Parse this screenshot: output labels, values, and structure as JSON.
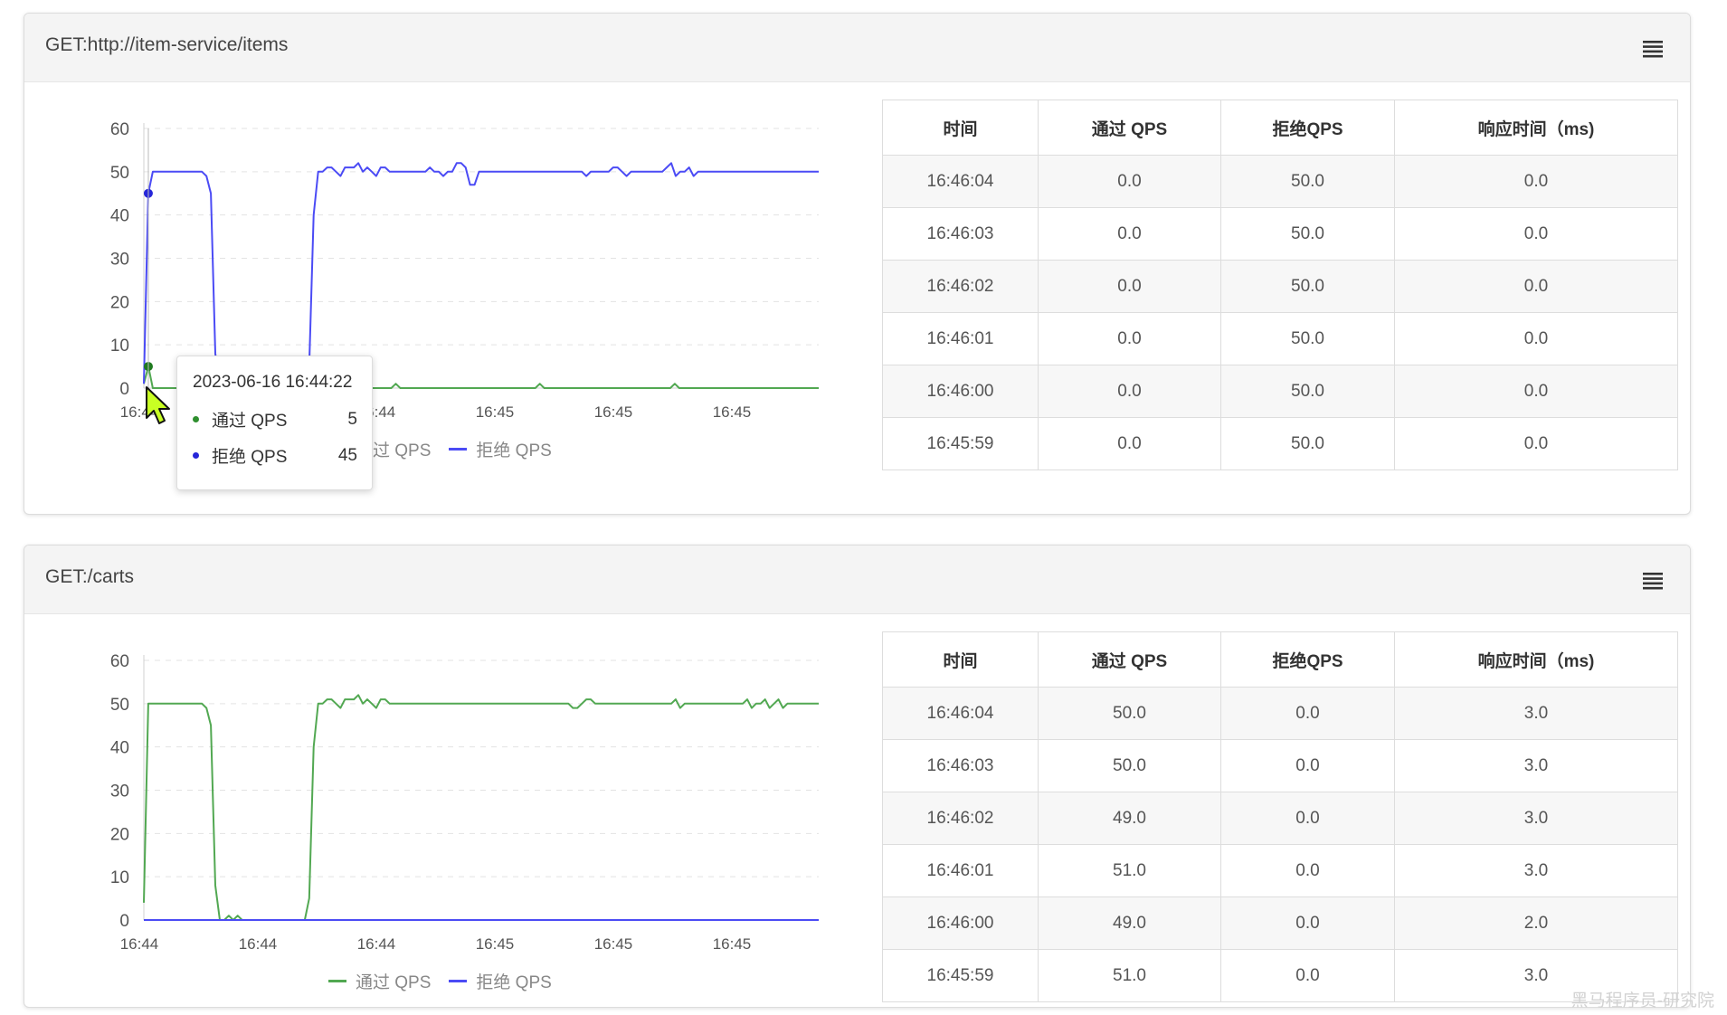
{
  "colors": {
    "pass": "#52a852",
    "reject": "#4b4bf5"
  },
  "panels": [
    {
      "title": "GET:http://item-service/items",
      "legend": [
        "通过 QPS",
        "拒绝 QPS"
      ],
      "table": {
        "headers": [
          "时间",
          "通过 QPS",
          "拒绝QPS",
          "响应时间（ms)"
        ],
        "rows": [
          [
            "16:46:04",
            "0.0",
            "50.0",
            "0.0"
          ],
          [
            "16:46:03",
            "0.0",
            "50.0",
            "0.0"
          ],
          [
            "16:46:02",
            "0.0",
            "50.0",
            "0.0"
          ],
          [
            "16:46:01",
            "0.0",
            "50.0",
            "0.0"
          ],
          [
            "16:46:00",
            "0.0",
            "50.0",
            "0.0"
          ],
          [
            "16:45:59",
            "0.0",
            "50.0",
            "0.0"
          ]
        ]
      },
      "tooltip": {
        "title": "2023-06-16 16:44:22",
        "rows": [
          {
            "label": "通过 QPS",
            "value": "5"
          },
          {
            "label": "拒绝 QPS",
            "value": "45"
          }
        ]
      }
    },
    {
      "title": "GET:/carts",
      "legend": [
        "通过 QPS",
        "拒绝 QPS"
      ],
      "table": {
        "headers": [
          "时间",
          "通过 QPS",
          "拒绝QPS",
          "响应时间（ms)"
        ],
        "rows": [
          [
            "16:46:04",
            "50.0",
            "0.0",
            "3.0"
          ],
          [
            "16:46:03",
            "50.0",
            "0.0",
            "3.0"
          ],
          [
            "16:46:02",
            "49.0",
            "0.0",
            "3.0"
          ],
          [
            "16:46:01",
            "51.0",
            "0.0",
            "3.0"
          ],
          [
            "16:46:00",
            "49.0",
            "0.0",
            "2.0"
          ],
          [
            "16:45:59",
            "51.0",
            "0.0",
            "3.0"
          ]
        ]
      }
    }
  ],
  "watermark": "黑马程序员-研究院",
  "chart_data": [
    {
      "type": "line",
      "ylim": [
        0,
        60
      ],
      "yticks": [
        0,
        10,
        20,
        30,
        40,
        50,
        60
      ],
      "x_tick_labels": [
        "16:44",
        "16:44",
        "16:44",
        "16:45",
        "16:45",
        "16:45"
      ],
      "grid": "horizontal dashed",
      "legend_position": "bottom-center",
      "series": [
        {
          "name": "通过 QPS",
          "color": "#52a852",
          "values": [
            1,
            5,
            0,
            0,
            0,
            0,
            0,
            0,
            0,
            0,
            0,
            0,
            0,
            0,
            0,
            0,
            0,
            0,
            0,
            0,
            0,
            0,
            0,
            0,
            0,
            0,
            0,
            0,
            0,
            0,
            0,
            0,
            0,
            0,
            0,
            0,
            0,
            0,
            0,
            0,
            0,
            0,
            0,
            0,
            0,
            0,
            0,
            0,
            0,
            0,
            0,
            0,
            0,
            0,
            0,
            0,
            1,
            0,
            0,
            0,
            0,
            0,
            0,
            0,
            0,
            0,
            0,
            0,
            0,
            0,
            0,
            0,
            0,
            0,
            0,
            0,
            0,
            0,
            0,
            0,
            0,
            0,
            0,
            0,
            0,
            0,
            0,
            0,
            1,
            0,
            0,
            0,
            0,
            0,
            0,
            0,
            0,
            0,
            0,
            0,
            0,
            0,
            0,
            0,
            0,
            0,
            0,
            0,
            0,
            0,
            0,
            0,
            0,
            0,
            0,
            0,
            0,
            0,
            1,
            0,
            0,
            0,
            0,
            0,
            0,
            0,
            0,
            0,
            0,
            0,
            0,
            0,
            0,
            0,
            0,
            0,
            0,
            0,
            0,
            0,
            0,
            0,
            0,
            0,
            0,
            0,
            0,
            0,
            0,
            0,
            0
          ]
        },
        {
          "name": "拒绝 QPS",
          "color": "#4b4bf5",
          "values": [
            1,
            45,
            50,
            50,
            50,
            50,
            50,
            50,
            50,
            50,
            50,
            50,
            50,
            50,
            49,
            45,
            8,
            0,
            0,
            0,
            0,
            0,
            0,
            0,
            0,
            0,
            0,
            0,
            0,
            0,
            0,
            0,
            0,
            0,
            0,
            0,
            0,
            5,
            40,
            50,
            50,
            51,
            51,
            50,
            49,
            51,
            51,
            51,
            52,
            50,
            51,
            50,
            49,
            51,
            51,
            50,
            50,
            50,
            50,
            50,
            50,
            50,
            50,
            50,
            51,
            50,
            50,
            49,
            50,
            50,
            52,
            52,
            51,
            47,
            47,
            50,
            50,
            50,
            50,
            50,
            50,
            50,
            50,
            50,
            50,
            50,
            50,
            50,
            50,
            50,
            50,
            50,
            50,
            50,
            50,
            50,
            50,
            50,
            50,
            49,
            50,
            50,
            50,
            50,
            50,
            51,
            51,
            50,
            49,
            50,
            50,
            50,
            50,
            50,
            50,
            50,
            50,
            51,
            52,
            49,
            50,
            50,
            51,
            49,
            50,
            50,
            50,
            50,
            50,
            50,
            50,
            50,
            50,
            50,
            50,
            50,
            50,
            50,
            50,
            50,
            50,
            50,
            50,
            50,
            50,
            50,
            50,
            50,
            50,
            50,
            50,
            50
          ]
        }
      ]
    },
    {
      "type": "line",
      "ylim": [
        0,
        60
      ],
      "yticks": [
        0,
        10,
        20,
        30,
        40,
        50,
        60
      ],
      "x_tick_labels": [
        "16:44",
        "16:44",
        "16:44",
        "16:45",
        "16:45",
        "16:45"
      ],
      "grid": "horizontal dashed",
      "legend_position": "bottom-center",
      "series": [
        {
          "name": "通过 QPS",
          "color": "#52a852",
          "values": [
            4,
            50,
            50,
            50,
            50,
            50,
            50,
            50,
            50,
            50,
            50,
            50,
            50,
            50,
            49,
            45,
            8,
            0,
            0,
            1,
            0,
            1,
            0,
            0,
            0,
            0,
            0,
            0,
            0,
            0,
            0,
            0,
            0,
            0,
            0,
            0,
            0,
            5,
            40,
            50,
            50,
            51,
            51,
            50,
            49,
            51,
            51,
            51,
            52,
            50,
            51,
            50,
            49,
            51,
            51,
            50,
            50,
            50,
            50,
            50,
            50,
            50,
            50,
            50,
            50,
            50,
            50,
            50,
            50,
            50,
            50,
            50,
            50,
            50,
            50,
            50,
            50,
            50,
            50,
            50,
            50,
            50,
            50,
            50,
            50,
            50,
            50,
            50,
            50,
            50,
            50,
            50,
            50,
            50,
            50,
            50,
            49,
            49,
            50,
            51,
            51,
            50,
            50,
            50,
            50,
            50,
            50,
            50,
            50,
            50,
            50,
            50,
            50,
            50,
            50,
            50,
            50,
            50,
            50,
            51,
            49,
            50,
            50,
            50,
            50,
            50,
            50,
            50,
            50,
            50,
            50,
            50,
            50,
            50,
            50,
            51,
            49,
            50,
            50,
            51,
            49,
            50,
            51,
            49,
            50,
            50,
            50,
            50,
            50,
            50,
            50,
            50
          ]
        },
        {
          "name": "拒绝 QPS",
          "color": "#4b4bf5",
          "values": [
            0,
            0,
            0,
            0,
            0,
            0,
            0,
            0,
            0,
            0,
            0,
            0,
            0,
            0,
            0,
            0,
            0,
            0,
            0,
            0,
            0,
            0,
            0,
            0,
            0,
            0,
            0,
            0,
            0,
            0,
            0,
            0,
            0,
            0,
            0,
            0,
            0,
            0,
            0,
            0,
            0,
            0,
            0,
            0,
            0,
            0,
            0,
            0,
            0,
            0,
            0,
            0,
            0,
            0,
            0,
            0,
            0,
            0,
            0,
            0,
            0,
            0,
            0,
            0,
            0,
            0,
            0,
            0,
            0,
            0,
            0,
            0,
            0,
            0,
            0,
            0,
            0,
            0,
            0,
            0,
            0,
            0,
            0,
            0,
            0,
            0,
            0,
            0,
            0,
            0,
            0,
            0,
            0,
            0,
            0,
            0,
            0,
            0,
            0,
            0,
            0,
            0,
            0,
            0,
            0,
            0,
            0,
            0,
            0,
            0,
            0,
            0,
            0,
            0,
            0,
            0,
            0,
            0,
            0,
            0,
            0,
            0,
            0,
            0,
            0,
            0,
            0,
            0,
            0,
            0,
            0,
            0,
            0,
            0,
            0,
            0,
            0,
            0,
            0,
            0,
            0,
            0,
            0,
            0,
            0,
            0,
            0,
            0,
            0,
            0
          ]
        }
      ]
    }
  ]
}
